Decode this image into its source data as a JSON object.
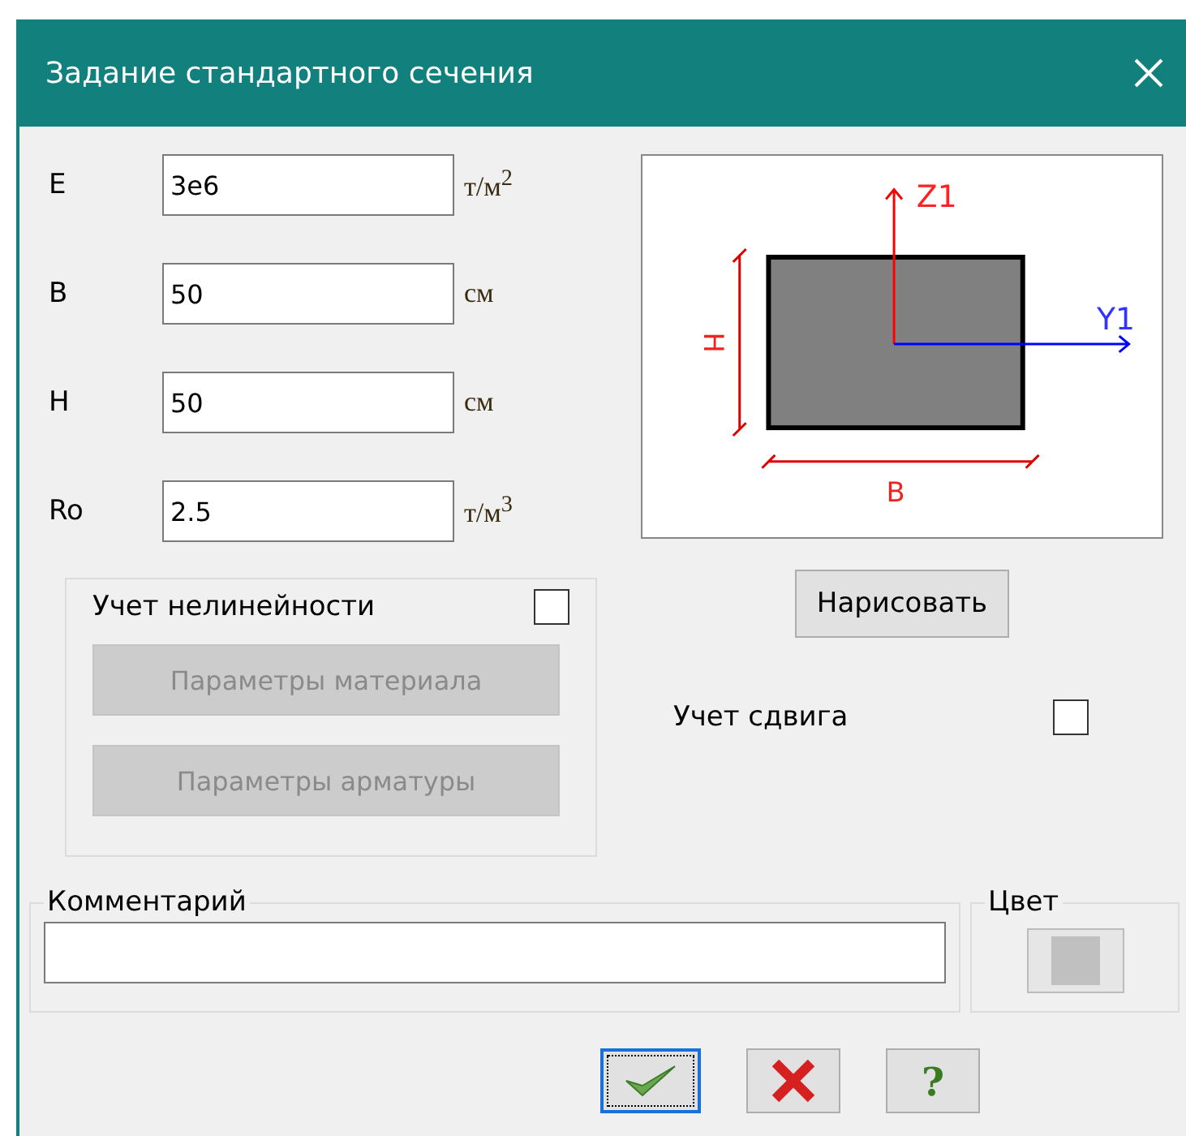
{
  "window": {
    "title": "Задание стандартного сечения"
  },
  "fields": [
    {
      "label": "E",
      "value": "3e6",
      "unit": "т/м$^{2}$"
    },
    {
      "label": "B",
      "value": "50",
      "unit": "см"
    },
    {
      "label": "H",
      "value": "50",
      "unit": "см"
    },
    {
      "label": "Ro",
      "value": "2.5",
      "unit": "т/м$^{3}$"
    }
  ],
  "diagram": {
    "z_axis": "Z1",
    "y_axis": "Y1",
    "height_label": "H",
    "width_label": "B"
  },
  "draw_button": {
    "label": "Нарисовать"
  },
  "nonlinearity": {
    "label": "Учет нелинейности",
    "checked": false,
    "buttons": [
      {
        "label": "Параметры материала",
        "disabled": true
      },
      {
        "label": "Параметры арматуры",
        "disabled": true
      }
    ]
  },
  "shear": {
    "label": "Учет сдвига",
    "checked": false
  },
  "comment": {
    "title": "Комментарий"
  },
  "color_group": {
    "title": "Цвет",
    "color": "#c0c0c0"
  },
  "footer_buttons": [
    {
      "kind": "ok",
      "focused": true
    },
    {
      "kind": "cancel",
      "focused": false
    },
    {
      "kind": "help",
      "label": "?",
      "focused": false
    }
  ]
}
